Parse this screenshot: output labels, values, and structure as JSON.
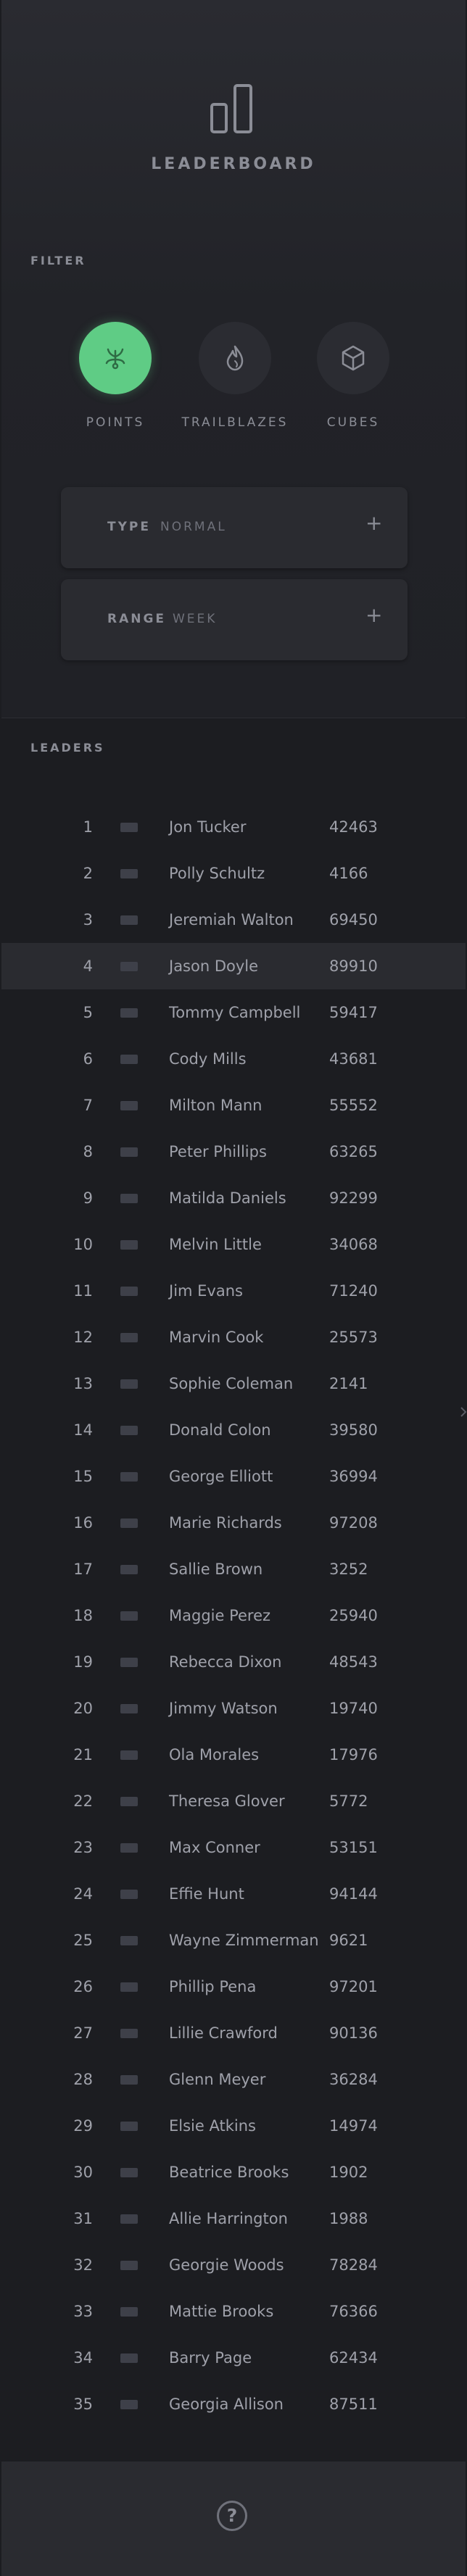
{
  "header": {
    "title": "LEADERBOARD",
    "icon": "bar-chart-icon"
  },
  "filter": {
    "label": "FILTER",
    "buttons": [
      {
        "label": "POINTS",
        "icon": "sprout-icon",
        "active": true
      },
      {
        "label": "TRAILBLAZES",
        "icon": "flame-icon",
        "active": false
      },
      {
        "label": "CUBES",
        "icon": "cube-icon",
        "active": false
      }
    ],
    "type": {
      "label": "TYPE",
      "value": "NORMAL"
    },
    "range": {
      "label": "RANGE",
      "value": "WEEK"
    }
  },
  "leaders": {
    "label": "LEADERS",
    "rows": [
      {
        "rank": "1",
        "name": "Jon Tucker",
        "score": "42463"
      },
      {
        "rank": "2",
        "name": "Polly Schultz",
        "score": "4166"
      },
      {
        "rank": "3",
        "name": "Jeremiah Walton",
        "score": "69450"
      },
      {
        "rank": "4",
        "name": "Jason Doyle",
        "score": "89910",
        "highlighted": true
      },
      {
        "rank": "5",
        "name": "Tommy Campbell",
        "score": "59417"
      },
      {
        "rank": "6",
        "name": "Cody Mills",
        "score": "43681"
      },
      {
        "rank": "7",
        "name": "Milton Mann",
        "score": "55552"
      },
      {
        "rank": "8",
        "name": "Peter Phillips",
        "score": "63265"
      },
      {
        "rank": "9",
        "name": "Matilda Daniels",
        "score": "92299"
      },
      {
        "rank": "10",
        "name": "Melvin Little",
        "score": "34068"
      },
      {
        "rank": "11",
        "name": "Jim Evans",
        "score": "71240"
      },
      {
        "rank": "12",
        "name": "Marvin Cook",
        "score": "25573"
      },
      {
        "rank": "13",
        "name": "Sophie Coleman",
        "score": "2141"
      },
      {
        "rank": "14",
        "name": "Donald Colon",
        "score": "39580"
      },
      {
        "rank": "15",
        "name": "George Elliott",
        "score": "36994"
      },
      {
        "rank": "16",
        "name": "Marie Richards",
        "score": "97208"
      },
      {
        "rank": "17",
        "name": "Sallie Brown",
        "score": "3252"
      },
      {
        "rank": "18",
        "name": "Maggie Perez",
        "score": "25940"
      },
      {
        "rank": "19",
        "name": "Rebecca Dixon",
        "score": "48543"
      },
      {
        "rank": "20",
        "name": "Jimmy Watson",
        "score": "19740"
      },
      {
        "rank": "21",
        "name": "Ola Morales",
        "score": "17976"
      },
      {
        "rank": "22",
        "name": "Theresa Glover",
        "score": "5772"
      },
      {
        "rank": "23",
        "name": "Max Conner",
        "score": "53151"
      },
      {
        "rank": "24",
        "name": "Effie Hunt",
        "score": "94144"
      },
      {
        "rank": "25",
        "name": "Wayne Zimmerman",
        "score": "9621"
      },
      {
        "rank": "26",
        "name": "Phillip Pena",
        "score": "97201"
      },
      {
        "rank": "27",
        "name": "Lillie Crawford",
        "score": "90136"
      },
      {
        "rank": "28",
        "name": "Glenn Meyer",
        "score": "36284"
      },
      {
        "rank": "29",
        "name": "Elsie Atkins",
        "score": "14974"
      },
      {
        "rank": "30",
        "name": "Beatrice Brooks",
        "score": "1902"
      },
      {
        "rank": "31",
        "name": "Allie Harrington",
        "score": "1988"
      },
      {
        "rank": "32",
        "name": "Georgie Woods",
        "score": "78284"
      },
      {
        "rank": "33",
        "name": "Mattie Brooks",
        "score": "76366"
      },
      {
        "rank": "34",
        "name": "Barry Page",
        "score": "62434"
      },
      {
        "rank": "35",
        "name": "Georgia Allison",
        "score": "87511"
      }
    ]
  },
  "footer": {
    "help_label": "?"
  },
  "colors": {
    "accent": "#5fcc85",
    "background": "#1c1d21",
    "panel": "#2a2b30",
    "text": "#9fa1aa"
  }
}
